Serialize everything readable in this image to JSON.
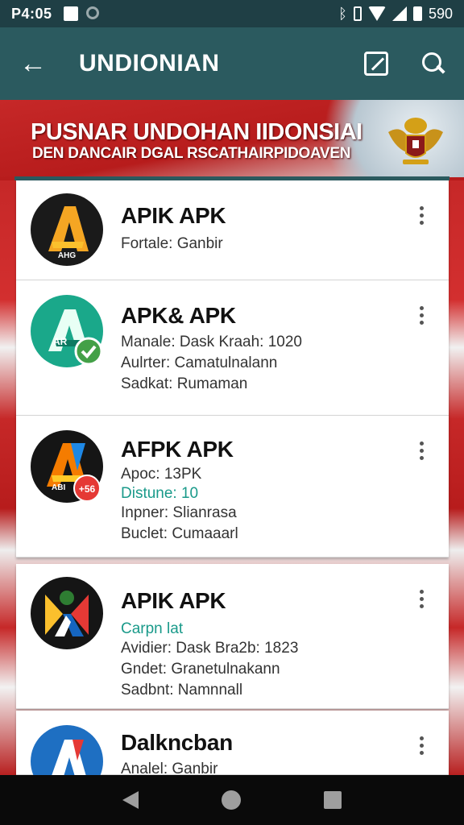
{
  "status_bar": {
    "time": "P4:05",
    "battery_text": "590"
  },
  "app_bar": {
    "title": "UNDIONIAN"
  },
  "banner": {
    "title": "PUSNAR UNDOHAN IIDONSIAI",
    "subtitle": "DEN DANCAIR DGAL RSCATHAIRPIDOAVEN"
  },
  "items": [
    {
      "title": "APIK APK",
      "lines": [
        "Fortale: Ganbir"
      ],
      "icon_text": "AHG"
    },
    {
      "title": "APK& APK",
      "lines": [
        "Manale:  Dask Kraah: 1020",
        "Aulrter: Camatulnalann",
        "Sadkat: Rumaman"
      ],
      "icon_text": "AR"
    },
    {
      "title": "AFPK APK",
      "lines": [
        "Apoc: 13PK",
        "Distune: 10",
        "Inpner: Slianrasa",
        "Buclet: Cumaaarl"
      ],
      "icon_text": "ABI",
      "badge": "+56"
    },
    {
      "title": "APIK APK",
      "lines": [
        "Carpn lat",
        "Avidier:  Dask Bra2b: 1823",
        "Gndet: Granetulnakann",
        "Sadbnt: Namnnall"
      ]
    },
    {
      "title": "Dalkncban",
      "lines": [
        "Analel: Ganbir"
      ]
    }
  ],
  "colors": {
    "app_bar": "#2b5a5f",
    "status_bar": "#1f3f45",
    "flag_red": "#b71c1c"
  }
}
